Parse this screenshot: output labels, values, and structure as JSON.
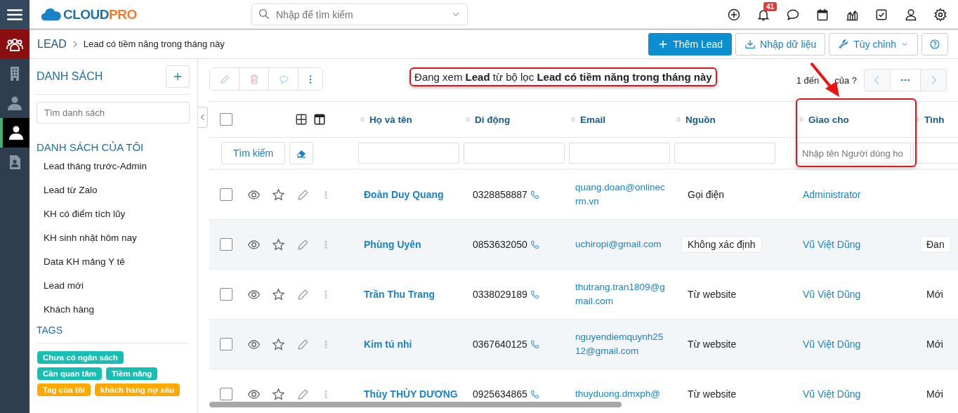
{
  "header": {
    "logo": [
      "CLOUD",
      "PRO"
    ],
    "search_placeholder": "Nhập để tìm kiếm",
    "notification_count": "41"
  },
  "rail": [
    {
      "kind": "menu",
      "selected": false
    },
    {
      "kind": "module",
      "selected": false
    },
    {
      "kind": "building",
      "selected": false
    },
    {
      "kind": "contact",
      "selected": false
    },
    {
      "kind": "person",
      "selected": true
    },
    {
      "kind": "document",
      "selected": false
    }
  ],
  "breadcrumb": {
    "module": "LEAD",
    "page": "Lead có tiềm năng trong tháng này"
  },
  "actions": [
    {
      "kind": "primary",
      "label": "Thêm Lead"
    },
    {
      "kind": "import",
      "label": "Nhập dữ liệu"
    },
    {
      "kind": "dropdown",
      "label": "Tùy chỉnh"
    },
    {
      "kind": "help"
    }
  ],
  "sidebar": {
    "title": "DANH SÁCH",
    "search_placeholder": "Tìm danh sách",
    "section": "DANH SÁCH CỦA TÔI",
    "lists": [
      "Lead tháng trước-Admin",
      "Lead từ Zalo",
      "KH có điểm tích lũy",
      "KH sinh nhật hôm nay",
      "Data KH mảng Y tê",
      "Lead mới",
      "Khách hàng"
    ],
    "tags_title": "TAGS",
    "tags": [
      {
        "label": "Chưa có ngân sách",
        "color": "#17bfb3"
      },
      {
        "label": "Cần quan tâm",
        "color": "#17bfb3"
      },
      {
        "label": "Tiềm năng",
        "color": "#17bfb3"
      },
      {
        "label": "Tag của tôi",
        "color": "#ffa800"
      },
      {
        "label": "khách hàng nợ xấu",
        "color": "#ffa800"
      }
    ]
  },
  "toolbar": {
    "banner": {
      "text": "Đang xem **Lead** từ bộ lọc **Lead có tiềm năng trong tháng này**",
      "highlighted": true
    },
    "pagination_start": "1 đến",
    "pagination_end": "của ?"
  },
  "table": {
    "select_all_checked": false,
    "columns": [
      {
        "label": "Họ và tên",
        "highlighted": false
      },
      {
        "label": "Di động",
        "highlighted": false
      },
      {
        "label": "Email",
        "highlighted": false
      },
      {
        "label": "Nguồn",
        "highlighted": false
      },
      {
        "label": "Giao cho",
        "highlighted": true
      },
      {
        "label": "Tình",
        "highlighted": false
      }
    ],
    "search_button": "Tìm kiếm",
    "assignee_filter_placeholder": "Nhập tên Người dùng ho",
    "rows": [
      {
        "checked": false,
        "name": "Đoàn Duy Quang",
        "phone": "0328858887",
        "email": "quang.doan@onlinecrm.vn",
        "source": "Gọi điện",
        "source_badge": false,
        "assignee": "Administrator"
      },
      {
        "checked": false,
        "name": "Phùng Uyên",
        "phone": "0853632050",
        "email": "uchiropi@gmail.com",
        "source": "Không xác định",
        "source_badge": true,
        "assignee": "Vũ Việt Dũng",
        "status": "Đan",
        "status_badge": true
      },
      {
        "checked": false,
        "name": "Trần Thu Trang",
        "phone": "0338029189",
        "email": "thutrang.tran1809@gmail.com",
        "source": "Từ website",
        "source_badge": false,
        "assignee": "Vũ Việt Dũng",
        "status": "Mới",
        "status_badge": false
      },
      {
        "checked": false,
        "name": "Kim tú nhi",
        "phone": "0367640125",
        "email": "nguyendiemquynh2512@gmail.com",
        "source": "Từ website",
        "source_badge": false,
        "assignee": "Vũ Việt Dũng",
        "status": "Mới",
        "status_badge": false
      },
      {
        "checked": false,
        "name": "Thùy THÙY DƯƠNG",
        "phone": "0925634865",
        "email": "thuyduong.dmxph@",
        "source": "Từ website",
        "source_badge": false,
        "assignee": "Vũ Việt Dũng",
        "status": "Mới",
        "status_badge": false
      }
    ]
  },
  "annotation_arrow": true
}
